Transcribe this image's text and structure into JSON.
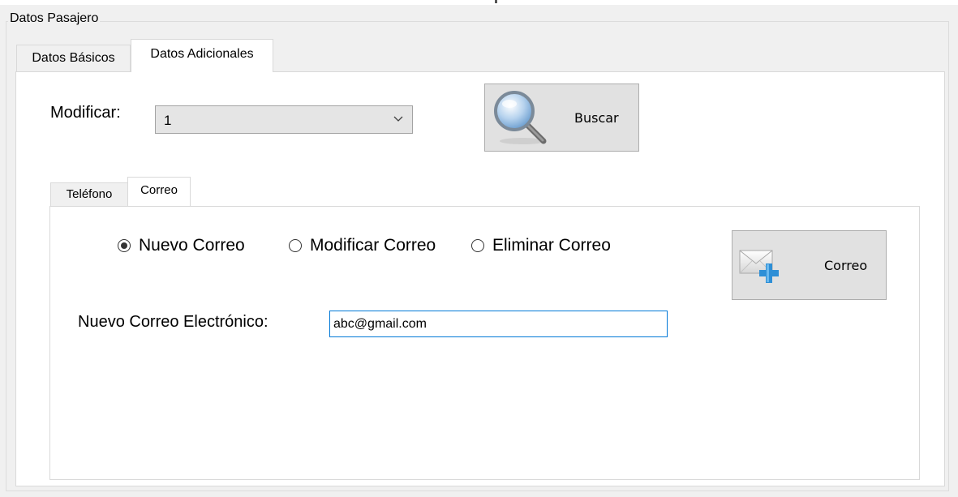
{
  "group": {
    "title": "Datos Pasajero"
  },
  "outer_tabs": [
    {
      "label": "Datos Básicos",
      "active": false
    },
    {
      "label": "Datos Adicionales",
      "active": true
    }
  ],
  "modify": {
    "label": "Modificar:",
    "selected_value": "1"
  },
  "buttons": {
    "search_label": "Buscar",
    "email_label": "Correo"
  },
  "inner_tabs": [
    {
      "label": "Teléfono",
      "active": false
    },
    {
      "label": "Correo",
      "active": true
    }
  ],
  "radios": [
    {
      "label": "Nuevo Correo",
      "checked": true
    },
    {
      "label": "Modificar Correo",
      "checked": false
    },
    {
      "label": "Eliminar Correo",
      "checked": false
    }
  ],
  "email": {
    "label": "Nuevo Correo Electrónico:",
    "value": "abc@gmail.com"
  },
  "colors": {
    "window_bg": "#f0f0f0",
    "panel_bg": "#ffffff",
    "focus_border": "#0078d7",
    "button_bg": "#e1e1e1"
  }
}
